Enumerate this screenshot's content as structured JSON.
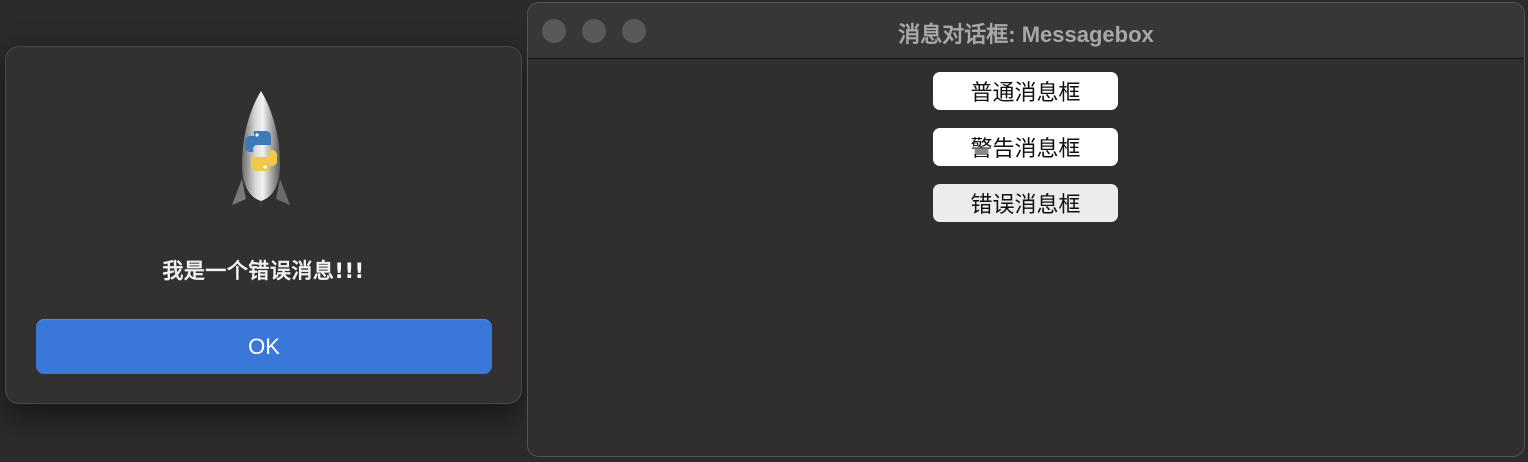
{
  "alert": {
    "message": "我是一个错误消息!!!",
    "ok_label": "OK",
    "icon": "python-launcher-rocket-icon"
  },
  "window": {
    "title": "消息对话框: Messagebox",
    "buttons": [
      {
        "label": "普通消息框"
      },
      {
        "label": "警告消息框"
      },
      {
        "label": "错误消息框"
      }
    ]
  },
  "colors": {
    "ok_button": "#3a78d8",
    "background": "#302f2f",
    "traffic_light_inactive": "#5a5858"
  }
}
